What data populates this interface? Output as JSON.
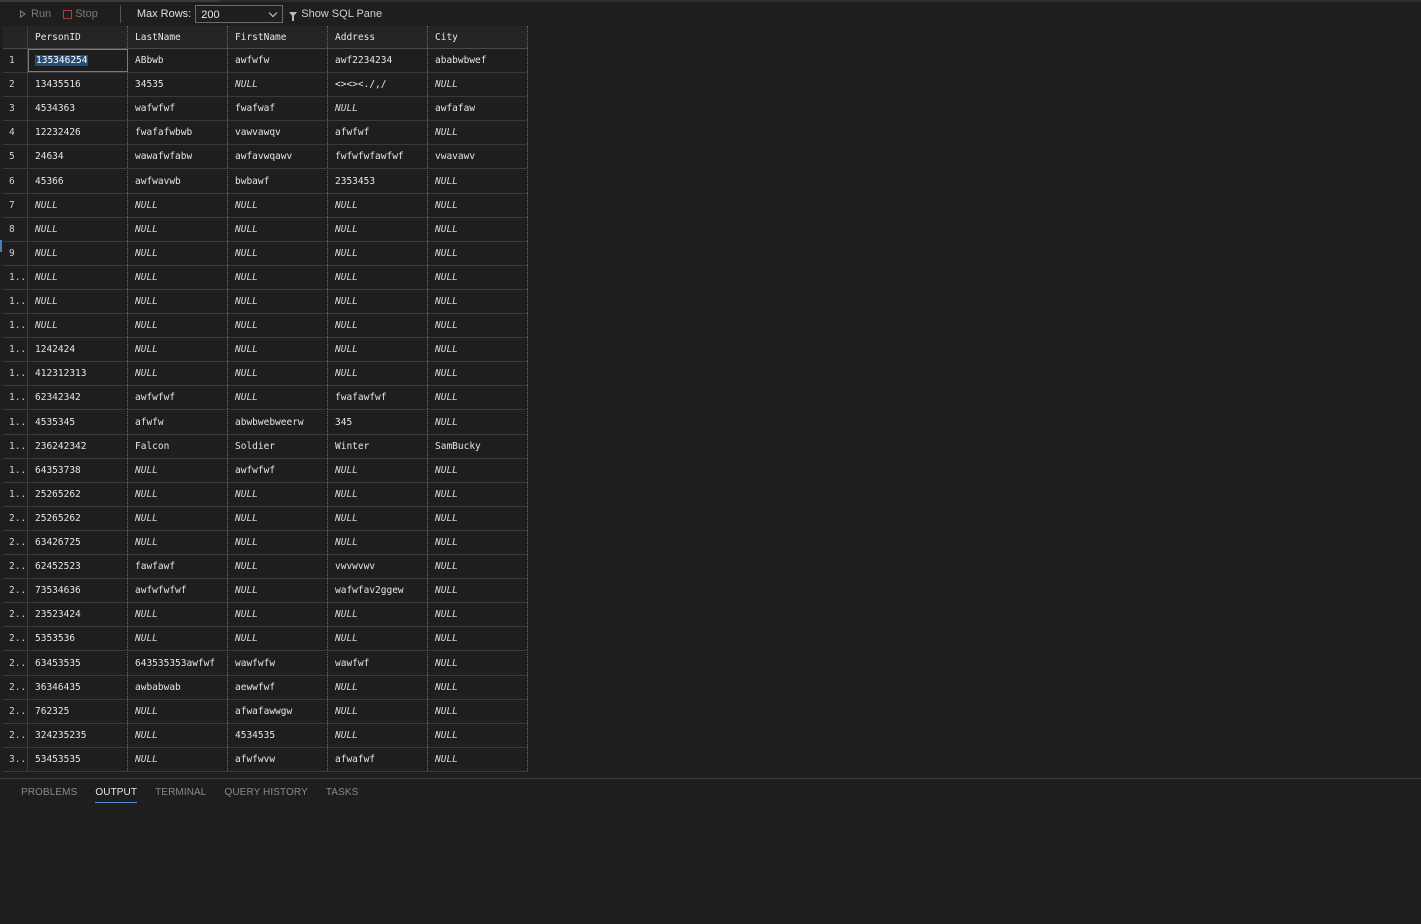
{
  "toolbar": {
    "run_label": "Run",
    "stop_label": "Stop",
    "max_rows_label": "Max Rows:",
    "max_rows_value": "200",
    "show_sql_label": "Show SQL Pane"
  },
  "grid": {
    "columns": [
      "PersonID",
      "LastName",
      "FirstName",
      "Address",
      "City"
    ],
    "rows": [
      {
        "n": "1",
        "cells": [
          "135346254",
          "ABbwb",
          "awfwfw",
          "awf2234234",
          "ababwbwef"
        ]
      },
      {
        "n": "2",
        "cells": [
          "13435516",
          "34535",
          "NULL",
          "<><><./,/",
          "NULL"
        ]
      },
      {
        "n": "3",
        "cells": [
          "4534363",
          "wafwfwf",
          "fwafwaf",
          "NULL",
          "awfafaw"
        ]
      },
      {
        "n": "4",
        "cells": [
          "12232426",
          "fwafafwbwb",
          "vawvawqv",
          "afwfwf",
          "NULL"
        ]
      },
      {
        "n": "5",
        "cells": [
          "24634",
          "wawafwfabw",
          "awfavwqawv",
          "fwfwfwfawfwf",
          "vwavawv"
        ]
      },
      {
        "n": "6",
        "cells": [
          "45366",
          "awfwavwb",
          "bwbawf",
          "2353453",
          "NULL"
        ]
      },
      {
        "n": "7",
        "cells": [
          "NULL",
          "NULL",
          "NULL",
          "NULL",
          "NULL"
        ]
      },
      {
        "n": "8",
        "cells": [
          "NULL",
          "NULL",
          "NULL",
          "NULL",
          "NULL"
        ]
      },
      {
        "n": "9",
        "cells": [
          "NULL",
          "NULL",
          "NULL",
          "NULL",
          "NULL"
        ]
      },
      {
        "n": "1...",
        "cells": [
          "NULL",
          "NULL",
          "NULL",
          "NULL",
          "NULL"
        ]
      },
      {
        "n": "1...",
        "cells": [
          "NULL",
          "NULL",
          "NULL",
          "NULL",
          "NULL"
        ]
      },
      {
        "n": "1...",
        "cells": [
          "NULL",
          "NULL",
          "NULL",
          "NULL",
          "NULL"
        ]
      },
      {
        "n": "1...",
        "cells": [
          "1242424",
          "NULL",
          "NULL",
          "NULL",
          "NULL"
        ]
      },
      {
        "n": "1...",
        "cells": [
          "412312313",
          "NULL",
          "NULL",
          "NULL",
          "NULL"
        ]
      },
      {
        "n": "1...",
        "cells": [
          "62342342",
          "awfwfwf",
          "NULL",
          "fwafawfwf",
          "NULL"
        ]
      },
      {
        "n": "1...",
        "cells": [
          "4535345",
          "afwfw",
          "abwbwebweerw",
          "345",
          "NULL"
        ]
      },
      {
        "n": "1...",
        "cells": [
          "236242342",
          "Falcon",
          "Soldier",
          "Winter",
          "SamBucky"
        ]
      },
      {
        "n": "1...",
        "cells": [
          "64353738",
          "NULL",
          "awfwfwf",
          "NULL",
          "NULL"
        ]
      },
      {
        "n": "1...",
        "cells": [
          "25265262",
          "NULL",
          "NULL",
          "NULL",
          "NULL"
        ]
      },
      {
        "n": "2...",
        "cells": [
          "25265262",
          "NULL",
          "NULL",
          "NULL",
          "NULL"
        ]
      },
      {
        "n": "2...",
        "cells": [
          "63426725",
          "NULL",
          "NULL",
          "NULL",
          "NULL"
        ]
      },
      {
        "n": "2...",
        "cells": [
          "62452523",
          "fawfawf",
          "NULL",
          "vwvwvwv",
          "NULL"
        ]
      },
      {
        "n": "2...",
        "cells": [
          "73534636",
          "awfwfwfwf",
          "NULL",
          "wafwfav2ggew",
          "NULL"
        ]
      },
      {
        "n": "2...",
        "cells": [
          "23523424",
          "NULL",
          "NULL",
          "NULL",
          "NULL"
        ]
      },
      {
        "n": "2...",
        "cells": [
          "5353536",
          "NULL",
          "NULL",
          "NULL",
          "NULL"
        ]
      },
      {
        "n": "2...",
        "cells": [
          "63453535",
          "643535353awfwf",
          "wawfwfw",
          "wawfwf",
          "NULL"
        ]
      },
      {
        "n": "2...",
        "cells": [
          "36346435",
          "awbabwab",
          "aewwfwf",
          "NULL",
          "NULL"
        ]
      },
      {
        "n": "2...",
        "cells": [
          "762325",
          "NULL",
          "afwafawwgw",
          "NULL",
          "NULL"
        ]
      },
      {
        "n": "2...",
        "cells": [
          "324235235",
          "NULL",
          "4534535",
          "NULL",
          "NULL"
        ]
      },
      {
        "n": "3...",
        "cells": [
          "53453535",
          "NULL",
          "afwfwvw",
          "afwafwf",
          "NULL"
        ]
      }
    ]
  },
  "panel": {
    "tabs": [
      {
        "label": "PROBLEMS"
      },
      {
        "label": "OUTPUT"
      },
      {
        "label": "TERMINAL"
      },
      {
        "label": "QUERY HISTORY"
      },
      {
        "label": "TASKS"
      }
    ],
    "active_tab": 1
  },
  "colors": {
    "background": "#1e1e1e",
    "selection": "#264f78",
    "active_tab_underline": "#4f8fd1",
    "stop_icon": "#b33a3a"
  }
}
